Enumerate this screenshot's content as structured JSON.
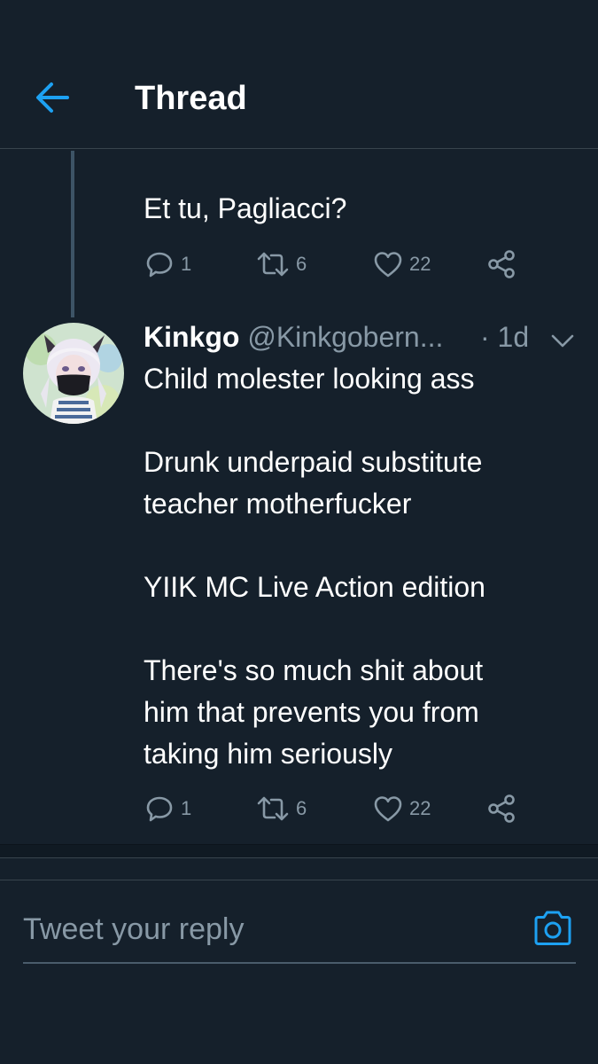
{
  "header": {
    "title": "Thread",
    "back_icon": "arrow-left-icon",
    "accent": "#1da1f2"
  },
  "parent_tweet": {
    "text": "Et tu, Pagliacci?",
    "stats": {
      "replies": "1",
      "retweets": "6",
      "likes": "22"
    }
  },
  "tweet": {
    "author": {
      "name": "Kinkgo",
      "handle": "@Kinkgobern...",
      "avatar_icon": "user-avatar"
    },
    "time": "· 1d",
    "text": "Child molester looking ass\n\nDrunk underpaid substitute\nteacher motherfucker\n\nYIIK MC Live Action edition\n\nThere's so much shit about\nhim that prevents you from\ntaking him seriously",
    "stats": {
      "replies": "1",
      "retweets": "6",
      "likes": "22"
    }
  },
  "reply": {
    "placeholder": "Tweet your reply",
    "camera_icon": "camera-icon"
  },
  "colors": {
    "background": "#15202b",
    "secondary_text": "#8899a6",
    "border": "#38444d"
  }
}
